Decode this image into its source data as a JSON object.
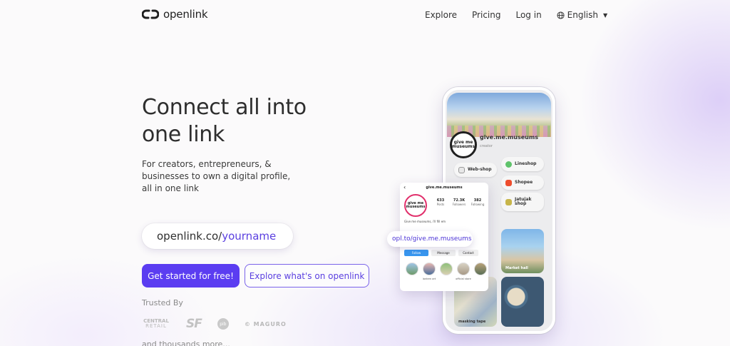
{
  "nav": {
    "logo_text": "openlink",
    "links": [
      "Explore",
      "Pricing",
      "Log in"
    ],
    "language": "English"
  },
  "hero": {
    "title_line1": "Connect all into",
    "title_line2": "one link",
    "subtitle": "For creators, entrepreneurs, & businesses to own a digital profile, all in one link",
    "url_prefix": "openlink.co/",
    "url_suffix": "yourname",
    "cta_primary": "Get started for free!",
    "cta_secondary": "Explore what's on openlink",
    "trusted_label": "Trusted By",
    "brands": {
      "central_line1": "CENTRAL",
      "central_line2": "RETAIL",
      "sf": "SF",
      "circle": "pib",
      "maguro": "© MAGURO"
    },
    "more": "and thousands more..."
  },
  "phone": {
    "profile_name": "give.me.museums",
    "profile_role": "creator",
    "avatar_text": "give me museums",
    "chips": [
      "Web-shop",
      "Lineshop",
      "Shopee",
      "Jatujak shop"
    ],
    "tiles": [
      "Market hall",
      "masking tape"
    ]
  },
  "ig": {
    "username": "give.me.museums",
    "back": "‹",
    "avatar_text": "give me museums",
    "stats": [
      {
        "num": "633",
        "label": "Posts"
      },
      {
        "num": "72.3K",
        "label": "Followers"
      },
      {
        "num": "382",
        "label": "Following"
      }
    ],
    "bio": "Give me museums, i'll fill em",
    "link": "opl.to/give.me.museums",
    "buttons": [
      "Follow",
      "Message",
      "Contact"
    ],
    "highlights": [
      "",
      "lantern art",
      "",
      "official store",
      ""
    ]
  },
  "colors": {
    "accent": "#5b3df1",
    "accent_text": "#5a3fe0"
  }
}
